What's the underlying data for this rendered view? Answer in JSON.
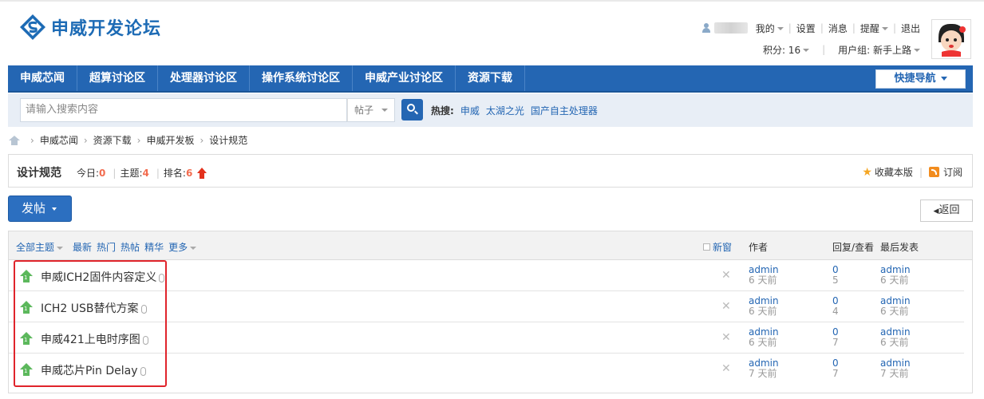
{
  "logo": {
    "text": "申威开发论坛"
  },
  "user": {
    "menu_my": "我的",
    "settings": "设置",
    "messages": "消息",
    "reminders": "提醒",
    "logout": "退出",
    "points": "积分: 16",
    "usergroup": "用户组: 新手上路"
  },
  "nav": {
    "items": [
      "申威芯闻",
      "超算讨论区",
      "处理器讨论区",
      "操作系统讨论区",
      "申威产业讨论区",
      "资源下载"
    ],
    "quick_nav": "快捷导航"
  },
  "search": {
    "placeholder": "请输入搜索内容",
    "type": "帖子",
    "hot_label": "热搜:",
    "hot_links": [
      "申威",
      "太湖之光",
      "国产自主处理器"
    ]
  },
  "breadcrumb": [
    "申威芯闻",
    "资源下载",
    "申威开发板",
    "设计规范"
  ],
  "forum": {
    "title": "设计规范",
    "today_label": "今日:",
    "today": "0",
    "topics_label": "主题:",
    "topics": "4",
    "rank_label": "排名:",
    "rank": "6",
    "favorite": "收藏本版",
    "subscribe": "订阅"
  },
  "buttons": {
    "post": "发帖",
    "back": "返回"
  },
  "thread_list": {
    "filters": {
      "all": "全部主题",
      "latest": "最新",
      "hot": "热门",
      "hotpost": "热帖",
      "digest": "精华",
      "more": "更多"
    },
    "newwin": "新窗",
    "col_author": "作者",
    "col_reply": "回复/查看",
    "col_last": "最后发表",
    "rows": [
      {
        "title": "申威ICH2固件内容定义",
        "author": "admin",
        "date": "6 天前",
        "replies": "0",
        "views": "5",
        "last_user": "admin",
        "last_date": "6 天前"
      },
      {
        "title": "ICH2 USB替代方案",
        "author": "admin",
        "date": "6 天前",
        "replies": "0",
        "views": "4",
        "last_user": "admin",
        "last_date": "6 天前"
      },
      {
        "title": "申威421上电时序图",
        "author": "admin",
        "date": "6 天前",
        "replies": "0",
        "views": "7",
        "last_user": "admin",
        "last_date": "6 天前"
      },
      {
        "title": "申威芯片Pin Delay",
        "author": "admin",
        "date": "7 天前",
        "replies": "0",
        "views": "7",
        "last_user": "admin",
        "last_date": "7 天前"
      }
    ]
  },
  "colors": {
    "brand": "#2466b3",
    "accent_red": "#e0242b",
    "stat_num": "#f26c4f",
    "thread_icon": "#5cb85c"
  }
}
